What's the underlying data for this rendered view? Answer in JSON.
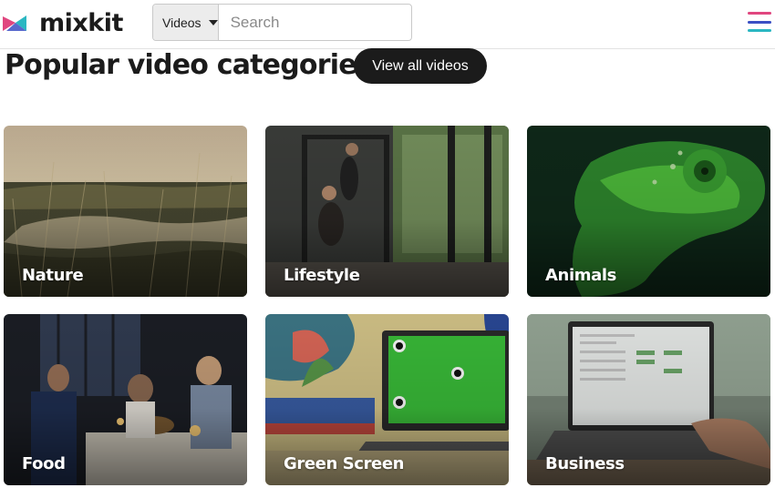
{
  "header": {
    "logo_text": "mixkit",
    "search": {
      "category_selected": "Videos",
      "placeholder": "Search"
    },
    "menu_colors": [
      "#e0467f",
      "#3b4fc4",
      "#2bb7c2"
    ]
  },
  "section": {
    "title": "Popular video categories",
    "view_all_label": "View all videos"
  },
  "categories": [
    {
      "label": "Nature"
    },
    {
      "label": "Lifestyle"
    },
    {
      "label": "Animals"
    },
    {
      "label": "Food"
    },
    {
      "label": "Green Screen"
    },
    {
      "label": "Business"
    }
  ]
}
